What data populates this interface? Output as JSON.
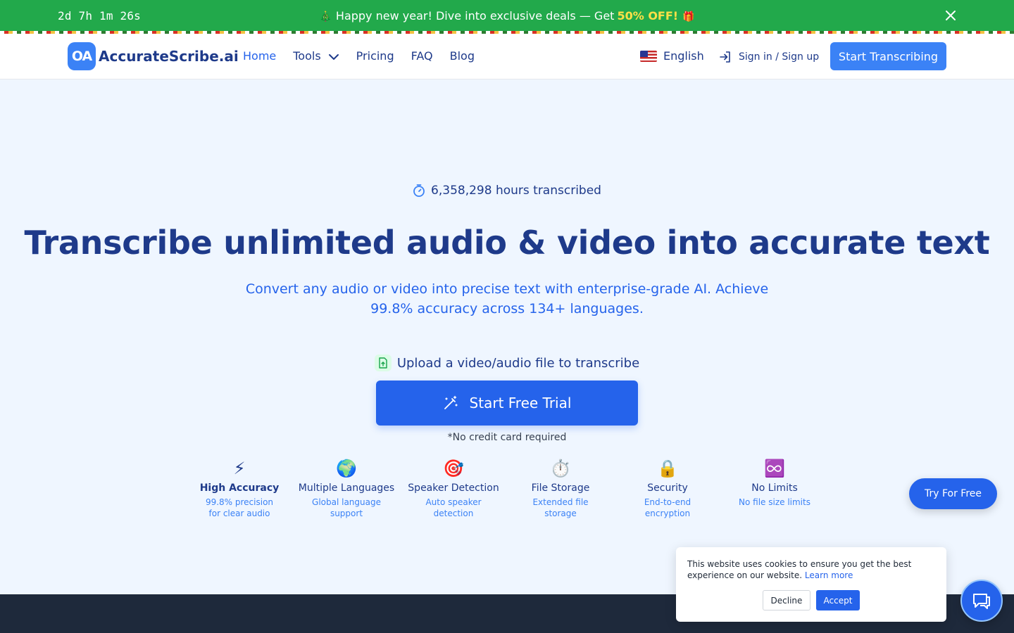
{
  "promo": {
    "countdown": "2d 7h 1m 26s",
    "emoji_left": "🎄",
    "message": "Happy new year! Dive into exclusive deals — Get",
    "highlight": "50% OFF!",
    "emoji_right": "🎁",
    "close_icon": "close-icon",
    "background": "#22a94b",
    "highlight_color": "#fde047"
  },
  "header": {
    "logo_mark": "OA",
    "logo_text": "AccurateScribe.ai",
    "nav": {
      "home": "Home",
      "tools": "Tools",
      "pricing": "Pricing",
      "faq": "FAQ",
      "blog": "Blog"
    },
    "language": "English",
    "signin": "Sign in / Sign up",
    "cta": "Start Transcribing",
    "accent": "#3b82f6"
  },
  "hero": {
    "hours": "6,358,298 hours transcribed",
    "title": "Transcribe unlimited audio & video into accurate text",
    "subtitle": "Convert any audio or video into precise text with enterprise-grade AI. Achieve 99.8% accuracy across 134+ languages.",
    "upload": "Upload a video/audio file to transcribe",
    "trial_button": "Start Free Trial",
    "no_card": "*No credit card required",
    "title_color": "#1e3a8a",
    "button_color": "#2563eb"
  },
  "features": [
    {
      "icon": "⚡",
      "icon_name": "lightning-icon",
      "title": "High Accuracy",
      "desc": "99.8% precision for clear audio"
    },
    {
      "icon": "🌍",
      "icon_name": "globe-icon",
      "title": "Multiple Languages",
      "desc": "Global language support"
    },
    {
      "icon": "🎯",
      "icon_name": "target-icon",
      "title": "Speaker Detection",
      "desc": "Auto speaker detection"
    },
    {
      "icon": "⏱️",
      "icon_name": "stopwatch-icon",
      "title": "File Storage",
      "desc": "Extended file storage"
    },
    {
      "icon": "🔒",
      "icon_name": "lock-icon",
      "title": "Security",
      "desc": "End-to-end encryption"
    },
    {
      "icon": "♾️",
      "icon_name": "infinity-icon",
      "title": "No Limits",
      "desc": "No file size limits"
    }
  ],
  "floating": {
    "try_free": "Try For Free",
    "chat_icon": "chat-icon"
  },
  "cookie": {
    "text": "This website uses cookies to ensure you get the best experience on our website.",
    "learn_more": "Learn more",
    "decline": "Decline",
    "accept": "Accept"
  }
}
